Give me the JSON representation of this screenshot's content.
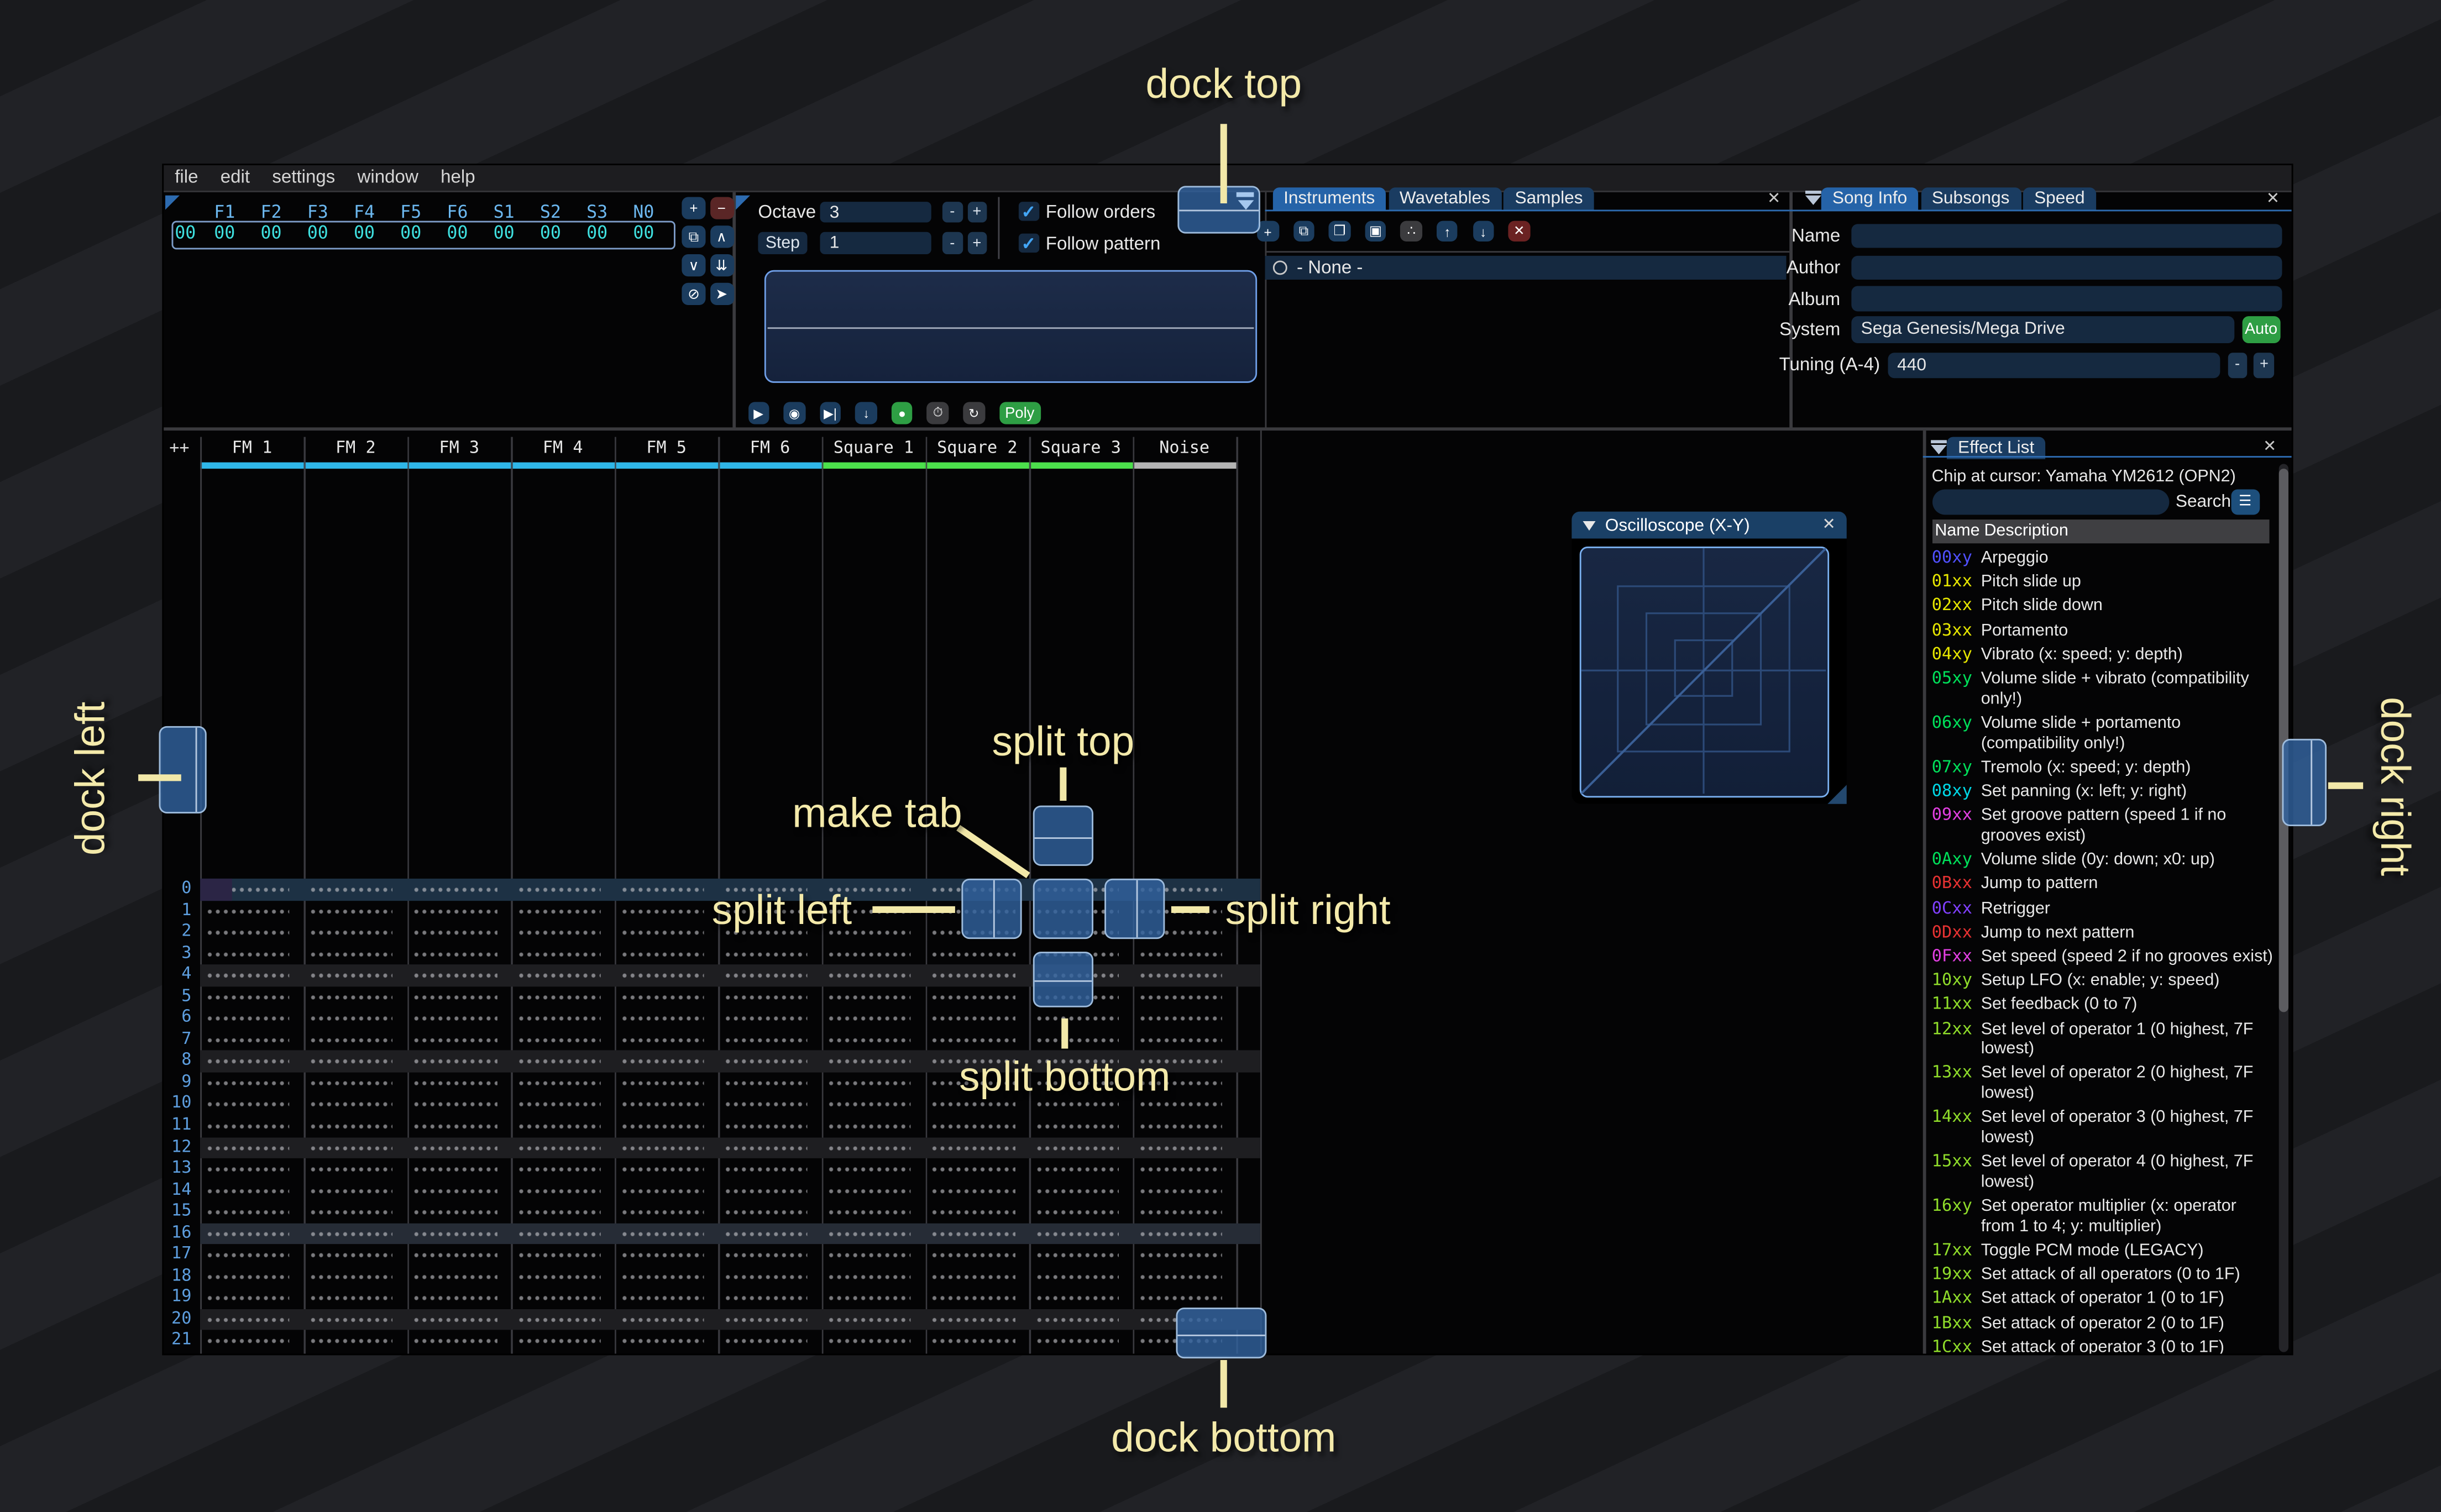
{
  "annotations": {
    "dock_top": "dock top",
    "dock_bottom": "dock bottom",
    "dock_left": "dock left",
    "dock_right": "dock right",
    "split_top": "split top",
    "split_bottom": "split bottom",
    "split_left": "split left",
    "split_right": "split right",
    "make_tab": "make tab",
    "color": "#f4eaaa"
  },
  "menu": {
    "items": [
      "file",
      "edit",
      "settings",
      "window",
      "help"
    ]
  },
  "orders": {
    "columns": [
      "F1",
      "F2",
      "F3",
      "F4",
      "F5",
      "F6",
      "S1",
      "S2",
      "S3",
      "N0"
    ],
    "row_label": "00",
    "row_values": [
      "00",
      "00",
      "00",
      "00",
      "00",
      "00",
      "00",
      "00",
      "00",
      "00"
    ],
    "buttons": [
      {
        "name": "add-order-button",
        "glyph": "+",
        "bg": "#1b3c5e"
      },
      {
        "name": "remove-order-button",
        "glyph": "−",
        "bg": "#5a2626"
      },
      {
        "name": "duplicate-order-button",
        "glyph": "⧉",
        "bg": "#1b3c5e"
      },
      {
        "name": "move-order-up-button",
        "glyph": "∧",
        "bg": "#1b3c5e"
      },
      {
        "name": "move-order-down-button",
        "glyph": "∨",
        "bg": "#1b3c5e"
      },
      {
        "name": "duplicate-end-button",
        "glyph": "⇊",
        "bg": "#1b3c5e"
      },
      {
        "name": "deep-clone-button",
        "glyph": "⊘",
        "bg": "#1b3c5e"
      },
      {
        "name": "order-edit-mode-button",
        "glyph": "➤",
        "bg": "#1b3c5e"
      }
    ]
  },
  "play_controls": {
    "octave_label": "Octave",
    "octave_value": "3",
    "step_label": "Step",
    "step_value": "1",
    "minus_label": "-",
    "plus_label": "+",
    "follow_orders": "Follow orders",
    "follow_pattern": "Follow pattern",
    "check_glyph": "✓",
    "transport": [
      {
        "name": "play-button",
        "glyph": "▶",
        "bg": "#1b3c5e",
        "cls": ""
      },
      {
        "name": "play-pattern-button",
        "glyph": "◉",
        "bg": "#1b3c5e",
        "cls": ""
      },
      {
        "name": "play-from-cursor-button",
        "glyph": "▶|",
        "bg": "#1b3c5e",
        "cls": ""
      },
      {
        "name": "step-one-row-button",
        "glyph": "↓",
        "bg": "#1b3c5e",
        "cls": ""
      },
      {
        "name": "record-button",
        "glyph": "●",
        "bg": "#2e9e44",
        "cls": ""
      },
      {
        "name": "metronome-button",
        "glyph": "⏱",
        "bg": "#3b3b3e",
        "cls": ""
      },
      {
        "name": "repeat-pattern-button",
        "glyph": "↻",
        "bg": "#3b3b3e",
        "cls": ""
      },
      {
        "name": "poly-button",
        "glyph": "Poly",
        "bg": "#2e9e44",
        "cls": "wide"
      }
    ]
  },
  "instruments": {
    "tabs": [
      {
        "label": "Instruments",
        "active": "1"
      },
      {
        "label": "Wavetables",
        "active": "0"
      },
      {
        "label": "Samples",
        "active": "0"
      }
    ],
    "close_glyph": "✕",
    "toolbar": [
      {
        "name": "add-instrument-button",
        "glyph": "+",
        "bg": "#1b3c5e"
      },
      {
        "name": "duplicate-instrument-button",
        "glyph": "⧉",
        "bg": "#1b3c5e"
      },
      {
        "name": "open-instrument-button",
        "glyph": "❐",
        "bg": "#1b3c5e"
      },
      {
        "name": "save-instrument-button",
        "glyph": "▣",
        "bg": "#1b3c5e"
      },
      {
        "name": "instrument-type-button",
        "glyph": "∴",
        "bg": "#3b3b3e"
      },
      {
        "name": "move-instrument-up-button",
        "glyph": "↑",
        "bg": "#1b3c5e"
      },
      {
        "name": "move-instrument-down-button",
        "glyph": "↓",
        "bg": "#1b3c5e"
      },
      {
        "name": "delete-instrument-button",
        "glyph": "✕",
        "bg": "#6b2222"
      }
    ],
    "list_item": "- None -"
  },
  "song_info": {
    "tabs": [
      {
        "label": "Song Info",
        "active": "1"
      },
      {
        "label": "Subsongs",
        "active": "0"
      },
      {
        "label": "Speed",
        "active": "0"
      }
    ],
    "close_glyph": "✕",
    "name_label": "Name",
    "name_value": "",
    "author_label": "Author",
    "author_value": "",
    "album_label": "Album",
    "album_value": "",
    "system_label": "System",
    "system_value": "Sega Genesis/Mega Drive",
    "auto_label": "Auto",
    "tuning_label": "Tuning (A-4)",
    "tuning_value": "440",
    "minus_label": "-",
    "plus_label": "+"
  },
  "pattern": {
    "corner_label": "++",
    "channels": [
      {
        "name": "FM 1",
        "color": "#2fb6e8"
      },
      {
        "name": "FM 2",
        "color": "#2fb6e8"
      },
      {
        "name": "FM 3",
        "color": "#2fb6e8"
      },
      {
        "name": "FM 4",
        "color": "#2fb6e8"
      },
      {
        "name": "FM 5",
        "color": "#2fb6e8"
      },
      {
        "name": "FM 6",
        "color": "#2fb6e8"
      },
      {
        "name": "Square 1",
        "color": "#4ce04c"
      },
      {
        "name": "Square 2",
        "color": "#4ce04c"
      },
      {
        "name": "Square 3",
        "color": "#4ce04c"
      },
      {
        "name": "Noise",
        "color": "#b4b4b4"
      }
    ],
    "rows": [
      {
        "n": "0",
        "cls": "current"
      },
      {
        "n": "1",
        "cls": ""
      },
      {
        "n": "2",
        "cls": ""
      },
      {
        "n": "3",
        "cls": ""
      },
      {
        "n": "4",
        "cls": "hl1"
      },
      {
        "n": "5",
        "cls": ""
      },
      {
        "n": "6",
        "cls": ""
      },
      {
        "n": "7",
        "cls": ""
      },
      {
        "n": "8",
        "cls": "hl1"
      },
      {
        "n": "9",
        "cls": ""
      },
      {
        "n": "10",
        "cls": ""
      },
      {
        "n": "11",
        "cls": ""
      },
      {
        "n": "12",
        "cls": "hl1"
      },
      {
        "n": "13",
        "cls": ""
      },
      {
        "n": "14",
        "cls": ""
      },
      {
        "n": "15",
        "cls": ""
      },
      {
        "n": "16",
        "cls": "hl2"
      },
      {
        "n": "17",
        "cls": ""
      },
      {
        "n": "18",
        "cls": ""
      },
      {
        "n": "19",
        "cls": ""
      },
      {
        "n": "20",
        "cls": "hl1"
      },
      {
        "n": "21",
        "cls": ""
      }
    ]
  },
  "oscilloscope": {
    "title": "Oscilloscope (X-Y)",
    "close_glyph": "✕"
  },
  "effect_list": {
    "tab_label": "Effect List",
    "close_glyph": "✕",
    "chip_text": "Chip at cursor: Yamaha YM2612 (OPN2)",
    "search_label": "Search",
    "menu_glyph": "☰",
    "name_col": "Name",
    "desc_col": "Description",
    "entries": [
      {
        "code": "00xy",
        "color": "#5050ff",
        "lines": [
          "Arpeggio"
        ]
      },
      {
        "code": "01xx",
        "color": "#e6e600",
        "lines": [
          "Pitch slide up"
        ]
      },
      {
        "code": "02xx",
        "color": "#e6e600",
        "lines": [
          "Pitch slide down"
        ]
      },
      {
        "code": "03xx",
        "color": "#e6e600",
        "lines": [
          "Portamento"
        ]
      },
      {
        "code": "04xy",
        "color": "#e6e600",
        "lines": [
          "Vibrato (x: speed; y: depth)"
        ]
      },
      {
        "code": "05xy",
        "color": "#00e05a",
        "lines": [
          "Volume slide + vibrato (compatibility",
          "only!)"
        ]
      },
      {
        "code": "06xy",
        "color": "#00e05a",
        "lines": [
          "Volume slide + portamento",
          "(compatibility only!)"
        ]
      },
      {
        "code": "07xy",
        "color": "#00e05a",
        "lines": [
          "Tremolo (x: speed; y: depth)"
        ]
      },
      {
        "code": "08xy",
        "color": "#00d8e6",
        "lines": [
          "Set panning (x: left; y: right)"
        ]
      },
      {
        "code": "09xx",
        "color": "#e23fe2",
        "lines": [
          "Set groove pattern (speed 1 if no",
          "grooves exist)"
        ]
      },
      {
        "code": "0Axy",
        "color": "#00e05a",
        "lines": [
          "Volume slide (0y: down; x0: up)"
        ]
      },
      {
        "code": "0Bxx",
        "color": "#e63232",
        "lines": [
          "Jump to pattern"
        ]
      },
      {
        "code": "0Cxx",
        "color": "#8040ff",
        "lines": [
          "Retrigger"
        ]
      },
      {
        "code": "0Dxx",
        "color": "#e63232",
        "lines": [
          "Jump to next pattern"
        ]
      },
      {
        "code": "0Fxx",
        "color": "#e23fe2",
        "lines": [
          "Set speed (speed 2 if no grooves exist)"
        ]
      },
      {
        "code": "10xy",
        "color": "#8fdc2a",
        "lines": [
          "Setup LFO (x: enable; y: speed)"
        ]
      },
      {
        "code": "11xx",
        "color": "#8fdc2a",
        "lines": [
          "Set feedback (0 to 7)"
        ]
      },
      {
        "code": "12xx",
        "color": "#8fdc2a",
        "lines": [
          "Set level of operator 1 (0 highest, 7F",
          "lowest)"
        ]
      },
      {
        "code": "13xx",
        "color": "#8fdc2a",
        "lines": [
          "Set level of operator 2 (0 highest, 7F",
          "lowest)"
        ]
      },
      {
        "code": "14xx",
        "color": "#8fdc2a",
        "lines": [
          "Set level of operator 3 (0 highest, 7F",
          "lowest)"
        ]
      },
      {
        "code": "15xx",
        "color": "#8fdc2a",
        "lines": [
          "Set level of operator 4 (0 highest, 7F",
          "lowest)"
        ]
      },
      {
        "code": "16xy",
        "color": "#8fdc2a",
        "lines": [
          "Set operator multiplier (x: operator",
          "from 1 to 4; y: multiplier)"
        ]
      },
      {
        "code": "17xx",
        "color": "#8fdc2a",
        "lines": [
          "Toggle PCM mode (LEGACY)"
        ]
      },
      {
        "code": "19xx",
        "color": "#8fdc2a",
        "lines": [
          "Set attack of all operators (0 to 1F)"
        ]
      },
      {
        "code": "1Axx",
        "color": "#8fdc2a",
        "lines": [
          "Set attack of operator 1 (0 to 1F)"
        ]
      },
      {
        "code": "1Bxx",
        "color": "#8fdc2a",
        "lines": [
          "Set attack of operator 2 (0 to 1F)"
        ]
      },
      {
        "code": "1Cxx",
        "color": "#8fdc2a",
        "lines": [
          "Set attack of operator 3 (0 to 1F)"
        ]
      }
    ]
  }
}
